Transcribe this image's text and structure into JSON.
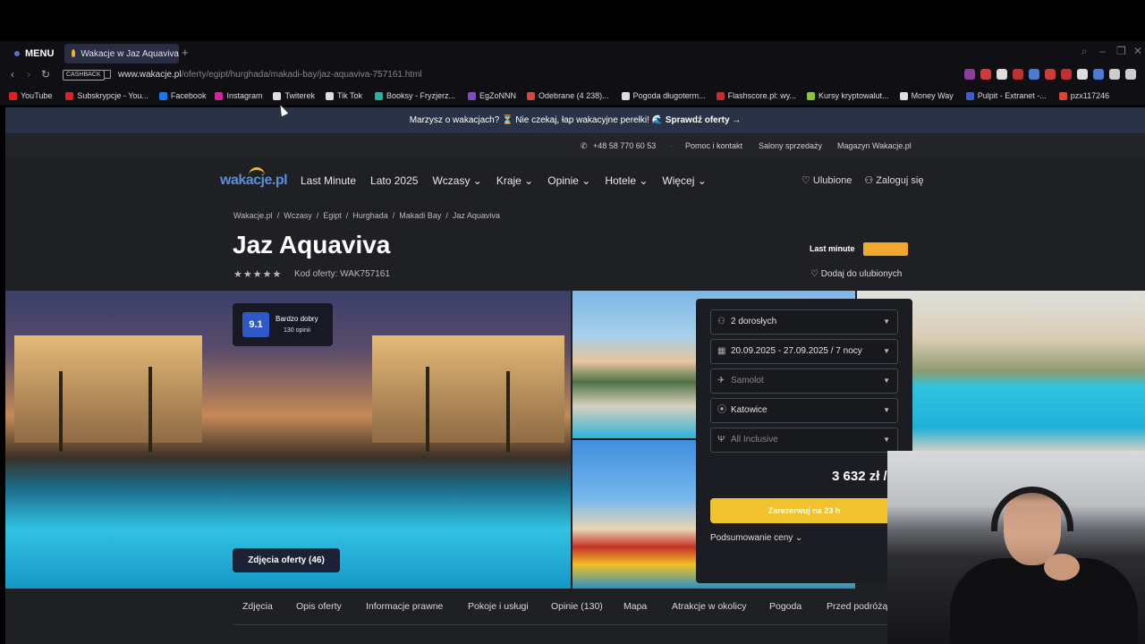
{
  "browser": {
    "menu_label": "MENU",
    "tab_title": "Wakacje w Jaz Aquaviva",
    "new_tab": "+",
    "cashback": "CASHBACK",
    "url_domain": "www.wakacje.pl",
    "url_path": "/oferty/egipt/hurghada/makadi-bay/jaz-aquaviva-757161.html",
    "bookmarks": [
      {
        "label": "YouTube",
        "color": "#e02020"
      },
      {
        "label": "Subskrypcje - You...",
        "color": "#e02020"
      },
      {
        "label": "Facebook",
        "color": "#1877f2"
      },
      {
        "label": "Instagram",
        "color": "#d6249f"
      },
      {
        "label": "Twiterek",
        "color": "#dddddd"
      },
      {
        "label": "Tik Tok",
        "color": "#dddddd"
      },
      {
        "label": "Booksy - Fryzjerz...",
        "color": "#1fb5a3"
      },
      {
        "label": "EgZoNNN",
        "color": "#7b4ad1"
      },
      {
        "label": "Odebrane (4 238)...",
        "color": "#e04434"
      },
      {
        "label": "Pogoda długoterm...",
        "color": "#dddddd"
      },
      {
        "label": "Flashscore.pl: wy...",
        "color": "#d7252b"
      },
      {
        "label": "Kursy kryptowalut...",
        "color": "#8cc63f"
      },
      {
        "label": "Money Way",
        "color": "#dddddd"
      },
      {
        "label": "Pulpit - Extranet -...",
        "color": "#3b63c4"
      },
      {
        "label": "pzx117246",
        "color": "#e04434"
      }
    ]
  },
  "promo": {
    "text": "Marzysz o wakacjach? ⏳  Nie czekaj, łap wakacyjne perełki! 🌊",
    "cta": "Sprawdź oferty →"
  },
  "topinfo": {
    "phone": "+48 58 770 60 53",
    "help": "Pomoc i kontakt",
    "salons": "Salony sprzedaży",
    "magazine": "Magazyn Wakacje.pl"
  },
  "header": {
    "logo": "wakacje.pl",
    "nav": [
      "Last Minute",
      "Lato 2025",
      "Wczasy",
      "Kraje",
      "Opinie",
      "Hotele",
      "Więcej"
    ],
    "favorites": "Ulubione",
    "login": "Zaloguj się"
  },
  "breadcrumb": [
    "Wakacje.pl",
    "/",
    "Wczasy",
    "/",
    "Egipt",
    "/",
    "Hurghada",
    "/",
    "Makadi Bay",
    "/",
    "Jaz Aquaviva"
  ],
  "hotel": {
    "name": "Jaz Aquaviva",
    "stars": "★★★★★",
    "offer_code": "Kod oferty: WAK757161",
    "last_minute": "Last minute",
    "add_fav": "Dodaj do ulubionych",
    "rating_score": "9.1",
    "rating_label": "Bardzo dobry",
    "rating_count": "130 opinii",
    "photos_button": "Zdjęcia oferty (46)"
  },
  "booking": {
    "guests": "2 dorosłych",
    "dates": "20.09.2025 - 27.09.2025 / 7 nocy",
    "transport": "Samolot",
    "departure": "Katowice",
    "board": "All Inclusive",
    "price": "3 632 zł /",
    "book_button": "Zarezerwuj na 23 h",
    "summary": "Podsumowanie ceny"
  },
  "page_tabs": [
    "Zdjęcia",
    "Opis oferty",
    "Informacje prawne",
    "Pokoje i usługi",
    "Opinie (130)",
    "Mapa",
    "Atrakcje w okolicy",
    "Pogoda",
    "Przed podróżą"
  ]
}
